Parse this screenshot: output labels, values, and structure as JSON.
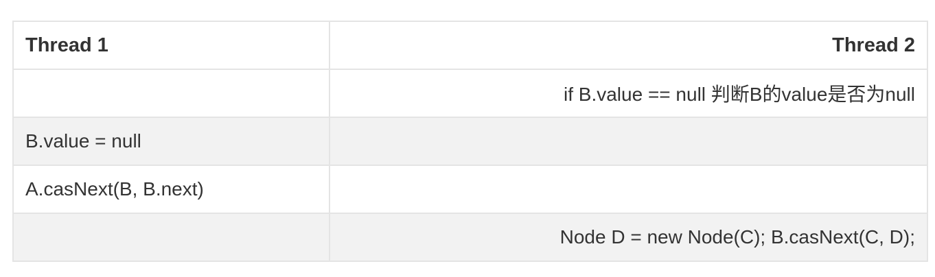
{
  "table": {
    "headers": [
      "Thread 1",
      "Thread 2"
    ],
    "rows": [
      [
        "",
        "if B.value == null 判断B的value是否为null"
      ],
      [
        "B.value = null",
        ""
      ],
      [
        "A.casNext(B, B.next)",
        ""
      ],
      [
        "",
        "Node D = new Node(C); B.casNext(C, D);"
      ]
    ]
  }
}
